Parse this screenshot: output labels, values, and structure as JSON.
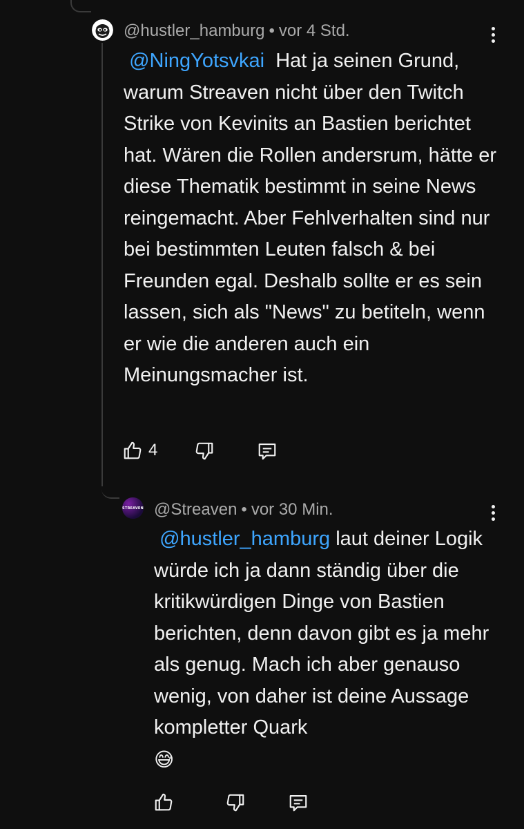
{
  "comment": {
    "author": "@hustler_hamburg",
    "separator": "•",
    "time": "vor 4 Std.",
    "mention": "@NingYotsvkai",
    "text": "Hat ja seinen Grund, warum Streaven nicht über den Twitch Strike von Kevinits an Bastien berichtet hat. Wären die Rollen andersrum, hätte er diese Thematik bestimmt in seine News reingemacht. Aber Fehlverhalten sind nur bei bestimmten Leuten falsch & bei Freunden egal. Deshalb sollte er es sein lassen, sich als \"News\" zu betiteln, wenn er wie die anderen auch ein Meinungsmacher ist.",
    "like_count": "4",
    "avatar_icon": "cartoon-face-avatar"
  },
  "reply": {
    "author": "@Streaven",
    "separator": "•",
    "time": "vor 30 Min.",
    "avatar_text": "STREAVEN",
    "mention": "@hustler_hamburg",
    "text": "laut deiner Logik würde ich ja dann ständig über die kritikwürdigen Dinge von Bastien berichten, denn davon gibt es ja mehr als genug. Mach ich aber genauso wenig, von daher ist deine Aussage kompletter Quark",
    "emoji": "😅"
  },
  "icons": {
    "like": "thumbs-up-icon",
    "dislike": "thumbs-down-icon",
    "reply": "reply-icon",
    "menu": "more-vert-icon"
  },
  "colors": {
    "background": "#0f0f0f",
    "text": "#f1f1f1",
    "meta": "#aaaaaa",
    "mention": "#3ea6ff",
    "thread_line": "#3a3a3a"
  }
}
